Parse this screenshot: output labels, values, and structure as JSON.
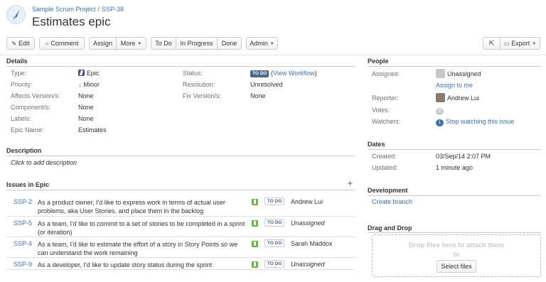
{
  "breadcrumb": {
    "project": "Sample Scrum Project",
    "separator": "/",
    "issue_key": "SSP-38"
  },
  "title": "Estimates epic",
  "toolbar": {
    "edit": "Edit",
    "comment": "Comment",
    "assign": "Assign",
    "more": "More",
    "todo": "To Do",
    "in_progress": "In Progress",
    "done": "Done",
    "admin": "Admin",
    "export": "Export"
  },
  "details": {
    "heading": "Details",
    "type_label": "Type:",
    "type_value": "Epic",
    "priority_label": "Priority:",
    "priority_value": "Minor",
    "affects_label": "Affects Version/s:",
    "affects_value": "None",
    "component_label": "Component/s:",
    "component_value": "None",
    "labels_label": "Labels:",
    "labels_value": "None",
    "epic_name_label": "Epic Name:",
    "epic_name_value": "Estimates",
    "status_label": "Status:",
    "status_value": "TO DO",
    "view_workflow_open": "(",
    "view_workflow": "View Workflow",
    "view_workflow_close": ")",
    "resolution_label": "Resolution:",
    "resolution_value": "Unresolved",
    "fix_label": "Fix Version/s:",
    "fix_value": "None"
  },
  "description": {
    "heading": "Description",
    "placeholder": "Click to add description"
  },
  "issues_in_epic": {
    "heading": "Issues in Epic",
    "rows": [
      {
        "key": "SSP-2",
        "summary": "As a product owner, I'd like to express work in terms of actual user problems, aka User Stories, and place them in the backlog",
        "status": "TO DO",
        "assignee": "Andrew Lui"
      },
      {
        "key": "SSP-5",
        "summary": "As a team, I'd like to commit to a set of stories to be completed in a sprint (or iteration)",
        "status": "TO DO",
        "assignee": "Unassigned"
      },
      {
        "key": "SSP-4",
        "summary": "As a team, I'd like to estimate the effort of a story in Story Points so we can understand the work remaining",
        "status": "TO DO",
        "assignee": "Sarah Maddox"
      },
      {
        "key": "SSP-9",
        "summary": "As a developer, I'd like to update story status during the sprint",
        "status": "TO DO",
        "assignee": "Unassigned"
      }
    ]
  },
  "people": {
    "heading": "People",
    "assignee_label": "Assignee:",
    "assignee_value": "Unassigned",
    "assign_to_me": "Assign to me",
    "reporter_label": "Reporter:",
    "reporter_value": "Andrew Lui",
    "votes_label": "Votes:",
    "votes_count": "0",
    "watchers_label": "Watchers:",
    "watchers_count": "1",
    "stop_watching": "Stop watching this issue"
  },
  "dates": {
    "heading": "Dates",
    "created_label": "Created:",
    "created_value": "03/Sep/14 2:07 PM",
    "updated_label": "Updated:",
    "updated_value": "1 minute ago"
  },
  "development": {
    "heading": "Development",
    "create_branch": "Create branch"
  },
  "drag_drop": {
    "heading": "Drag and Drop",
    "drop_text": "Drop files here to attach them",
    "or": "or",
    "select_files": "Select files"
  },
  "colors": {
    "link": "#3b73af",
    "lozenge": "#4a6785",
    "epic": "#654982",
    "story": "#63ba3c",
    "minor": "#2a8735"
  },
  "icons": [
    "rocket-project-icon",
    "pencil-icon",
    "speech-bubble-icon",
    "share-icon",
    "export-icon",
    "epic-icon",
    "arrow-down-icon",
    "story-icon",
    "plus-icon"
  ]
}
